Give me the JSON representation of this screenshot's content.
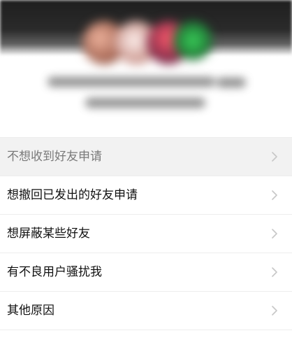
{
  "options": [
    {
      "label": "不想收到好友申请"
    },
    {
      "label": "想撤回已发出的好友申请"
    },
    {
      "label": "想屏蔽某些好友"
    },
    {
      "label": "有不良用户骚扰我"
    },
    {
      "label": "其他原因"
    }
  ],
  "icons": {
    "chevron": "chevron-right-icon"
  },
  "colors": {
    "header": "#1f1f1f",
    "divider": "#ededed",
    "text": "#111111",
    "chevron": "#c7c7c7",
    "pressed_row": "#f2f2f2"
  }
}
